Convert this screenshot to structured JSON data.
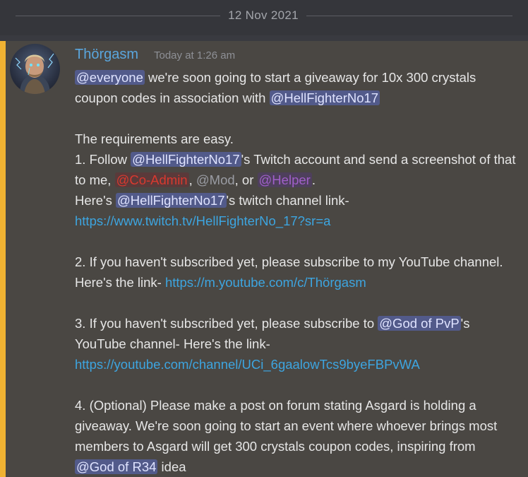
{
  "divider": {
    "date": "12 Nov 2021"
  },
  "message": {
    "author": "Thörgasm",
    "timestamp": "Today at 1:26 am",
    "mentions": {
      "everyone": "@everyone",
      "hellfighter": "@HellFighterNo17",
      "coadmin": "@Co-Admin",
      "mod": "@Mod",
      "helper": "@Helper",
      "god_pvp": "@God of PvP",
      "god_r34": "@God of R34"
    },
    "text": {
      "l1": " we're soon going to start a giveaway for 10x 300 crystals",
      "l2": "coupon codes in association with ",
      "l3": "The requirements are easy.",
      "l4a": "1. Follow ",
      "l4b": "'s Twitch account and send a screenshot of that",
      "l5a": "to me, ",
      "l5b": ", ",
      "l5c": ", or ",
      "l5d": ".",
      "l6a": "Here's ",
      "l6b": "'s twitch channel link-",
      "l8": "2. If you haven't subscribed yet, please subscribe to my YouTube channel.",
      "l9": "Here's the link- ",
      "l10a": "3. If you haven't subscribed yet, please subscribe to ",
      "l10b": "'s",
      "l11": "YouTube channel- Here's the link-",
      "l12": "4. (Optional) Please make a post on forum stating Asgard is holding a",
      "l13": "giveaway. We're soon going to start an event where whoever brings most",
      "l14": "members to Asgard will get 300 crystals coupon codes, inspiring from",
      "l15": " idea"
    },
    "links": {
      "twitch": "https://www.twitch.tv/HellFighterNo_17?sr=a",
      "youtube_own": "https://m.youtube.com/c/Thörgasm",
      "youtube_pvp": "https://youtube.com/channel/UCi_6gaalowTcs9byeFBPvWA"
    },
    "colors": {
      "accent": "#f0b232",
      "author": "#5aa6dd",
      "link": "#3da5e0",
      "mention_bg": "#525a8a"
    }
  }
}
